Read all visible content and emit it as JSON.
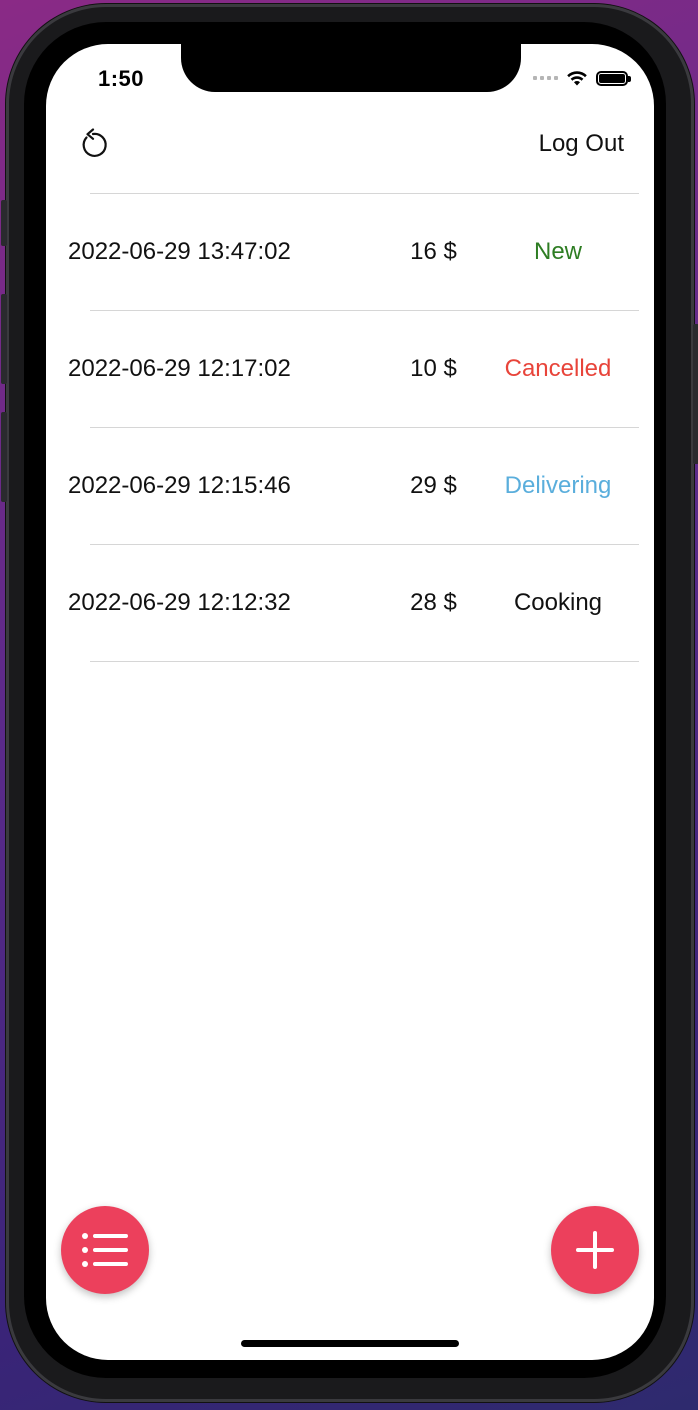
{
  "status_bar": {
    "time": "1:50",
    "icons": [
      "cellular-signal-icon",
      "wifi-icon",
      "battery-icon"
    ]
  },
  "header": {
    "refresh_icon": "refresh-icon",
    "logout_label": "Log Out"
  },
  "orders": [
    {
      "date": "2022-06-29 13:47:02",
      "price": "16 $",
      "status": "New"
    },
    {
      "date": "2022-06-29 12:17:02",
      "price": "10 $",
      "status": "Cancelled"
    },
    {
      "date": "2022-06-29 12:15:46",
      "price": "29 $",
      "status": "Delivering"
    },
    {
      "date": "2022-06-29 12:12:32",
      "price": "28 $",
      "status": "Cooking"
    }
  ],
  "status_colors": {
    "New": "#2e7d23",
    "Cancelled": "#e8443a",
    "Delivering": "#5aaedc",
    "Cooking": "#111111"
  },
  "fabs": {
    "list_icon": "list-icon",
    "add_icon": "plus-icon",
    "color": "#ec405c"
  }
}
